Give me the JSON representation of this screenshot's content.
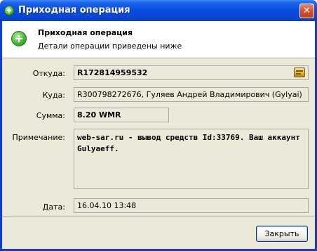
{
  "window": {
    "title": "Приходная операция",
    "close_glyph": "✕"
  },
  "header": {
    "title": "Приходная операция",
    "subtitle": "Детали операции приведены ниже",
    "icon": "plus-circle-icon"
  },
  "fields": {
    "from_label": "Откуда:",
    "from_value": "R172814959532",
    "to_label": "Куда:",
    "to_value": "R300798272676, Гуляев Андрей Владимирович (Gylyai)",
    "amount_label": "Сумма:",
    "amount_value": "8.20 WMR",
    "note_label": "Примечание:",
    "note_value": "web-sar.ru - вывод средств Id:33769. Ваш аккаунт Gulyaeff.",
    "date_label": "Дата:",
    "date_value": "16.04.10 13:48"
  },
  "buttons": {
    "close_label": "Закрыть"
  },
  "colors": {
    "titlebar": "#0a4ee0",
    "dialog_bg": "#ece9d8",
    "header_bg": "#ffffff"
  }
}
